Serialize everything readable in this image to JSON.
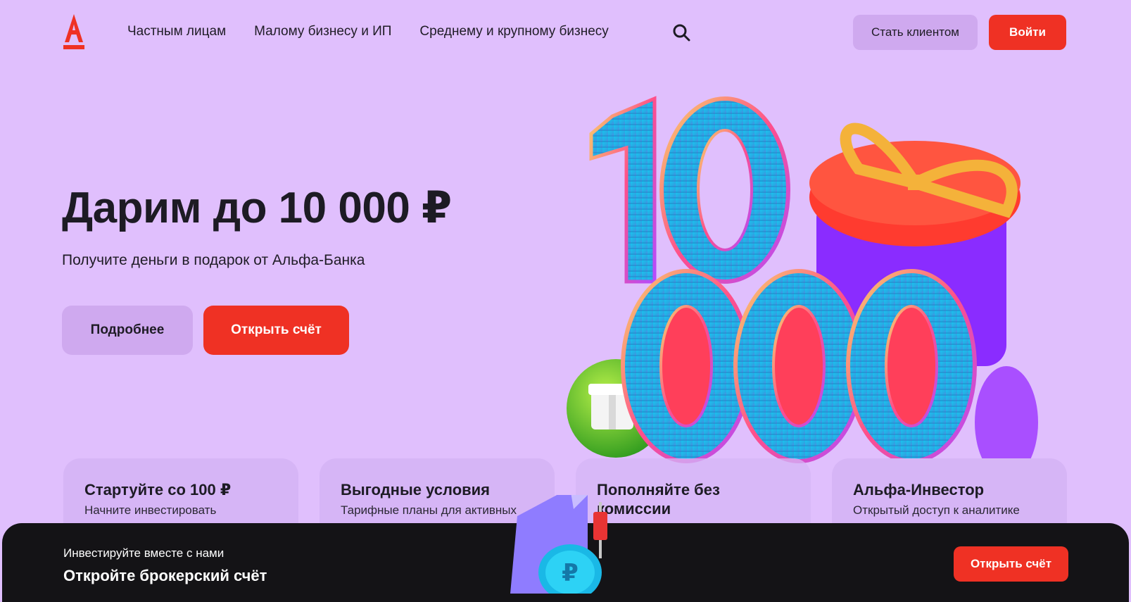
{
  "colors": {
    "background": "#e0bffd",
    "accent": "#ef3124",
    "secondary_button": "#cfa9ef",
    "card": "#d6b5f6",
    "banner": "#141316",
    "text": "#1d1b24"
  },
  "header": {
    "logo_icon": "alfa-logo-icon",
    "nav": [
      {
        "label": "Частным лицам"
      },
      {
        "label": "Малому бизнесу и ИП"
      },
      {
        "label": "Среднему и крупному бизнесу"
      }
    ],
    "search_icon": "search-icon",
    "become_client_label": "Стать клиентом",
    "login_label": "Войти"
  },
  "hero": {
    "title": "Дарим до 10 000 ₽",
    "subtitle": "Получите деньги в подарок от Альфа-Банка",
    "more_label": "Подробнее",
    "open_label": "Открыть счёт",
    "art_number": "10 000"
  },
  "cards": [
    {
      "title": "Стартуйте со 100 ₽",
      "text": "Начните инвестировать"
    },
    {
      "title": "Выгодные условия",
      "text": "Тарифные планы для активных"
    },
    {
      "title": "Пополняйте без комиссии",
      "text": ""
    },
    {
      "title": "Альфа-Инвестор",
      "text": "Открытый доступ к аналитике"
    }
  ],
  "banner": {
    "subtitle": "Инвестируйте вместе с нами",
    "title": "Откройте брокерский счёт",
    "button_label": "Открыть счёт",
    "art_icon": "ruble-coin-icon"
  }
}
